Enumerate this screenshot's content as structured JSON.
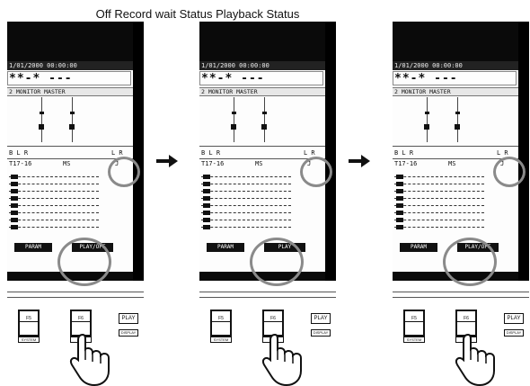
{
  "heading": "Off Record wait Status Playback Status",
  "panels": [
    {
      "date": "1/01/2000 00:00:00",
      "counter": "**-* ---",
      "monitor": "2 MONITOR MASTER",
      "lr_left": "B    L R",
      "lr_right": "L R",
      "lr_value": "J",
      "channels": "T17-16",
      "ms": "MS",
      "softkey_left": "PARAM",
      "softkey_right": "PLAY/OFF"
    },
    {
      "date": "1/01/2000 00:00:00",
      "counter": "**-* ---",
      "monitor": "2 MONITOR MASTER",
      "lr_left": "B    L R",
      "lr_right": "L R",
      "lr_value": "J",
      "channels": "T17-16",
      "ms": "MS",
      "softkey_left": "PARAM",
      "softkey_right": "PLAY"
    },
    {
      "date": "1/01/2000 00:00:00",
      "counter": "**-* ---",
      "monitor": "2 MONITOR MASTER",
      "lr_left": "B    L R",
      "lr_right": "L R",
      "lr_value": "J",
      "channels": "T17-16",
      "ms": "MS",
      "softkey_left": "PARAM",
      "softkey_right": "PLAY/OFF"
    }
  ],
  "hardware": {
    "f5": "F5",
    "f5_sub": "SYSTEM",
    "f6": "F6",
    "f6_sub": "",
    "play": "PLAY",
    "display": "DISPLAY"
  },
  "icons": {
    "arrow": "right-arrow-icon",
    "hand": "pointing-hand-icon"
  },
  "colors": {
    "screen_bg": "#fdfdfd",
    "bezel": "#0a0a0a",
    "highlight_circle": "#8a8a8a"
  }
}
